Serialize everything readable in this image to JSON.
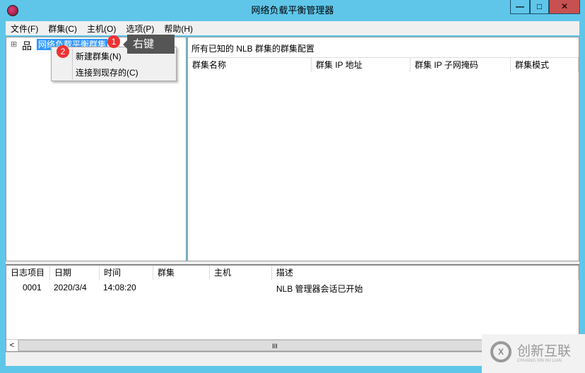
{
  "window": {
    "title": "网络负载平衡管理器",
    "min": "—",
    "max": "□",
    "close": "✕"
  },
  "menu": [
    "文件(F)",
    "群集(C)",
    "主机(O)",
    "选项(P)",
    "帮助(H)"
  ],
  "tree": {
    "expander": "⊞",
    "root": "网络负载平衡群集"
  },
  "context_menu": {
    "items": [
      "新建群集(N)",
      "连接到现存的(C)"
    ]
  },
  "annotations": {
    "step1": "1",
    "step2": "2",
    "tip": "右键"
  },
  "right_pane": {
    "caption": "所有已知的 NLB 群集的群集配置",
    "columns": [
      "群集名称",
      "群集 IP 地址",
      "群集 IP 子网掩码",
      "群集模式"
    ]
  },
  "log": {
    "columns": [
      "日志项目",
      "日期",
      "时间",
      "群集",
      "主机",
      "描述"
    ],
    "rows": [
      [
        "0001",
        "2020/3/4",
        "14:08:20",
        "",
        "",
        "NLB 管理器会话已开始"
      ]
    ]
  },
  "scrollbar": {
    "left": "<",
    "thumb": "III"
  },
  "watermark": {
    "name": "创新互联",
    "sub": "CHUANG XIN HU LIAN"
  }
}
